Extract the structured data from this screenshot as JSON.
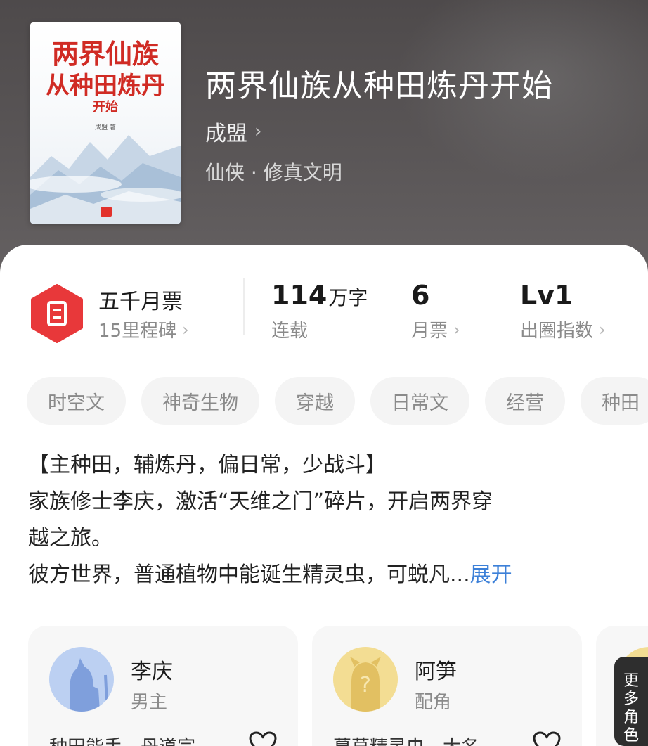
{
  "book": {
    "cover": {
      "title_line1": "两界仙族",
      "title_line2": "从种田炼丹",
      "title_line3": "开始",
      "author_mark": "成盟 著"
    },
    "title": "两界仙族从种田炼丹开始",
    "author": "成盟",
    "genre": "仙侠 · 修真文明"
  },
  "stats": {
    "monthly_ticket_title": "五千月票",
    "milestone_label": "15里程碑",
    "word_count_value": "114",
    "word_count_unit": "万字",
    "word_count_label": "连载",
    "monthly_votes_value": "6",
    "monthly_votes_label": "月票",
    "breakout_value": "Lv1",
    "breakout_label": "出圈指数"
  },
  "tags": [
    "时空文",
    "神奇生物",
    "穿越",
    "日常文",
    "经营",
    "种田"
  ],
  "description": {
    "line1": "【主种田，辅炼丹，偏日常，少战斗】",
    "line2": "家族修士李庆，激活“天维之门”碎片，开启两界穿",
    "line3": "越之旅。",
    "line4": "彼方世界，普通植物中能诞生精灵虫，可蜕凡...",
    "expand_label": "展开"
  },
  "characters": [
    {
      "name": "李庆",
      "role": "男主",
      "desc": "种田能手，丹道宗"
    },
    {
      "name": "阿笋",
      "role": "配角",
      "desc": "幕草精灵虫，大名"
    }
  ],
  "more_roles_label": [
    "更",
    "多",
    "角",
    "色"
  ],
  "colors": {
    "accent_red": "#e8383a",
    "link_blue": "#3c80d8",
    "header_bg": "#5a5657"
  }
}
